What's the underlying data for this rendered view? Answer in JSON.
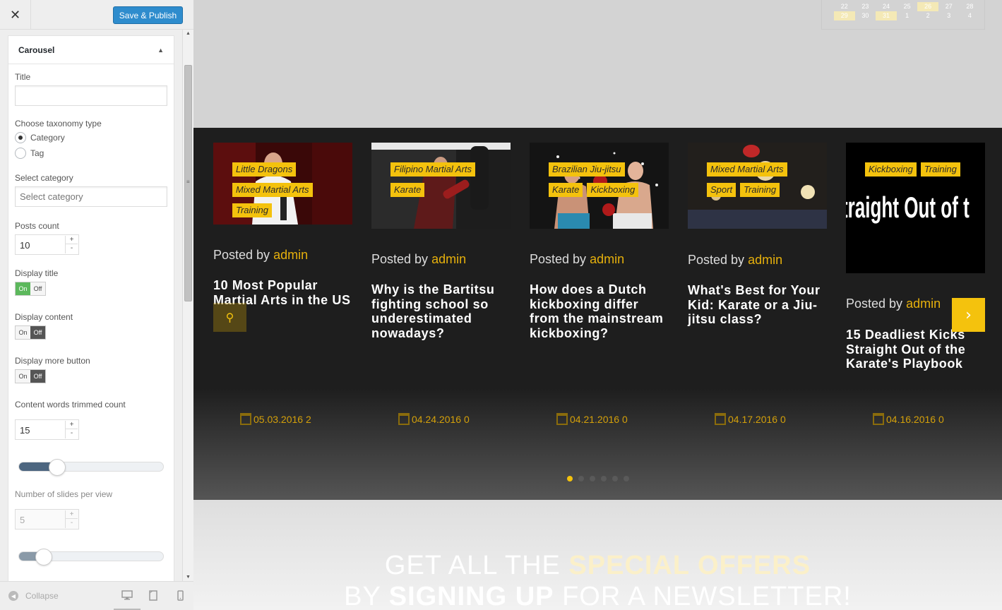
{
  "panel": {
    "close_icon": "close-icon",
    "save_label": "Save & Publish",
    "section_title": "Carousel",
    "title_label": "Title",
    "title_value": "",
    "taxonomy_label": "Choose taxonomy type",
    "taxonomy_options": [
      "Category",
      "Tag"
    ],
    "taxonomy_selected": "Category",
    "category_label": "Select category",
    "category_placeholder": "Select category",
    "posts_count_label": "Posts count",
    "posts_count_value": "10",
    "display_title_label": "Display title",
    "display_content_label": "Display content",
    "display_more_label": "Display more button",
    "toggle_on": "On",
    "toggle_off": "Off",
    "display_title": "On",
    "display_content": "Off",
    "display_more": "Off",
    "words_label": "Content words trimmed count",
    "words_value": "15",
    "words_slider": 0.26,
    "slides_label": "Number of slides per view",
    "slides_value": "5",
    "slides_slider": 0.17,
    "collapse_label": "Collapse",
    "stepper_up": "+",
    "stepper_down": "-"
  },
  "calendar": {
    "row1": [
      "22",
      "23",
      "24",
      "25",
      "26",
      "27",
      "28"
    ],
    "row2": [
      "29",
      "30",
      "31",
      "1",
      "2",
      "3",
      "4"
    ],
    "highlight": [
      "26",
      "29",
      "31"
    ]
  },
  "carousel": {
    "posted_by": "Posted by",
    "slides": [
      {
        "tags": [
          "Little Dragons",
          "Mixed Martial Arts",
          "Training"
        ],
        "author": "admin",
        "title": "10 Most Popular Martial Arts in the US",
        "date": "05.03.2016",
        "comments": "2"
      },
      {
        "tags": [
          "Filipino Martial Arts",
          "Karate"
        ],
        "author": "admin",
        "title": "Why is the Bartitsu fighting school so underestimated nowadays?",
        "date": "04.24.2016",
        "comments": "0"
      },
      {
        "tags": [
          "Brazilian Jiu-jitsu",
          "Karate",
          "Kickboxing"
        ],
        "author": "admin",
        "title": "How does a Dutch kickboxing differ from the mainstream kickboxing?",
        "date": "04.21.2016",
        "comments": "0"
      },
      {
        "tags": [
          "Mixed Martial Arts",
          "Sport",
          "Training"
        ],
        "author": "admin",
        "title": "What's Best for Your Kid: Karate or a Jiu-jitsu class?",
        "date": "04.17.2016",
        "comments": "0"
      },
      {
        "tags": [
          "Kickboxing",
          "Training"
        ],
        "author": "admin",
        "title": "15 Deadliest Kicks Straight Out of the Karate's Playbook",
        "date": "04.16.2016",
        "comments": "0",
        "image_text": "traight Out of t"
      }
    ],
    "dots": 6,
    "active_dot": 0,
    "prev_icon": "search-icon",
    "next_icon": "chevron-right-icon",
    "accent": "#f4c20d"
  },
  "newsletter": {
    "l1a": "GET ALL THE ",
    "l1b": "SPECIAL OFFERS",
    "l2a": "BY ",
    "l2b": "SIGNING UP",
    "l2c": " FOR A NEWSLETTER!"
  }
}
